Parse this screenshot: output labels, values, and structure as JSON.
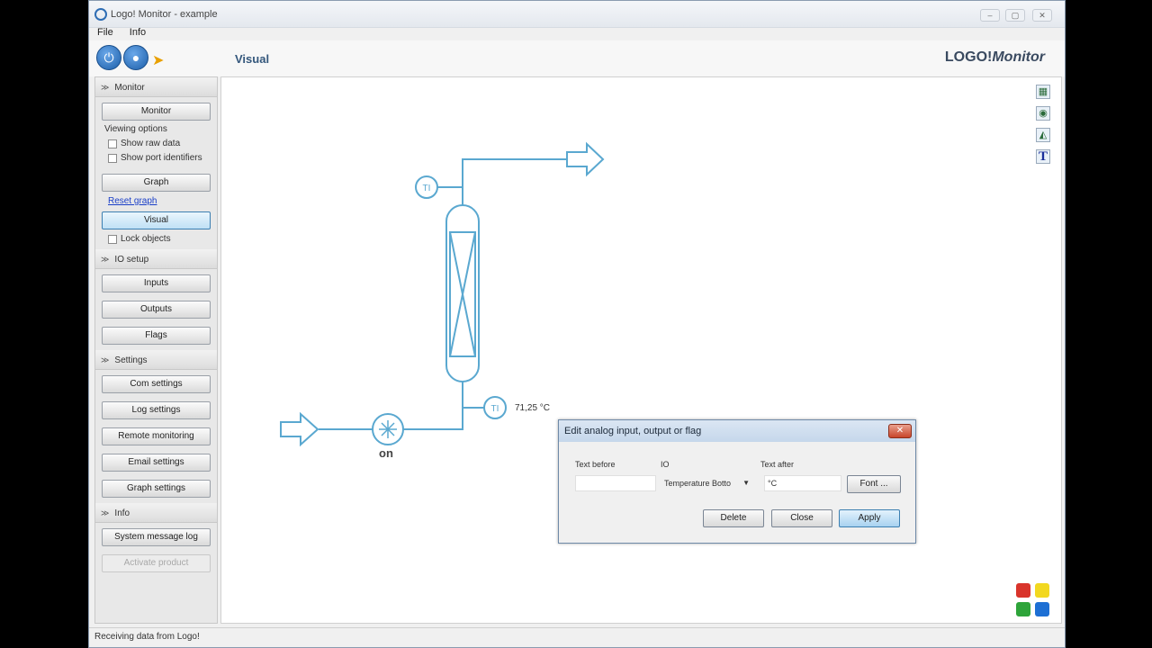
{
  "window": {
    "title": "Logo! Monitor - example",
    "buttons": [
      "–",
      "▢",
      "✕"
    ]
  },
  "menu": [
    "File",
    "Info"
  ],
  "toolbar": {
    "view_title": "Visual",
    "brand_logo": "LOGO!",
    "brand_name": "Monitor"
  },
  "sidebar": {
    "monitor": {
      "header": "Monitor",
      "monitor_button": "Monitor",
      "viewing_options": "Viewing options",
      "show_raw": "Show raw data",
      "show_port": "Show port identifiers",
      "graph_button": "Graph",
      "reset_graph": "Reset graph",
      "visual_button": "Visual",
      "lock_objects": "Lock objects"
    },
    "io_setup": {
      "header": "IO setup",
      "inputs": "Inputs",
      "outputs": "Outputs",
      "flags": "Flags"
    },
    "settings": {
      "header": "Settings",
      "com": "Com settings",
      "log": "Log settings",
      "remote": "Remote monitoring",
      "email": "Email settings",
      "graph": "Graph settings"
    },
    "info": {
      "header": "Info",
      "system_log": "System message log",
      "activate": "Activate product"
    }
  },
  "canvas": {
    "ti_top": "TI",
    "ti_bottom": "TI",
    "readout": "71,25 °C",
    "pump_state": "on",
    "tool_icons": [
      "image-icon",
      "target-icon",
      "chart-icon",
      "text-icon"
    ],
    "logo_colors": [
      "#d9342b",
      "#f2d820",
      "#2ea43a",
      "#1d6fd4"
    ]
  },
  "dialog": {
    "title": "Edit analog input, output or flag",
    "text_before_label": "Text before",
    "io_label": "IO",
    "text_after_label": "Text after",
    "text_before_value": "",
    "io_value": "Temperature Botto",
    "text_after_value": "°C",
    "font_button": "Font ...",
    "delete_button": "Delete",
    "close_button": "Close",
    "apply_button": "Apply"
  },
  "status": {
    "text": "Receiving data from Logo!"
  }
}
